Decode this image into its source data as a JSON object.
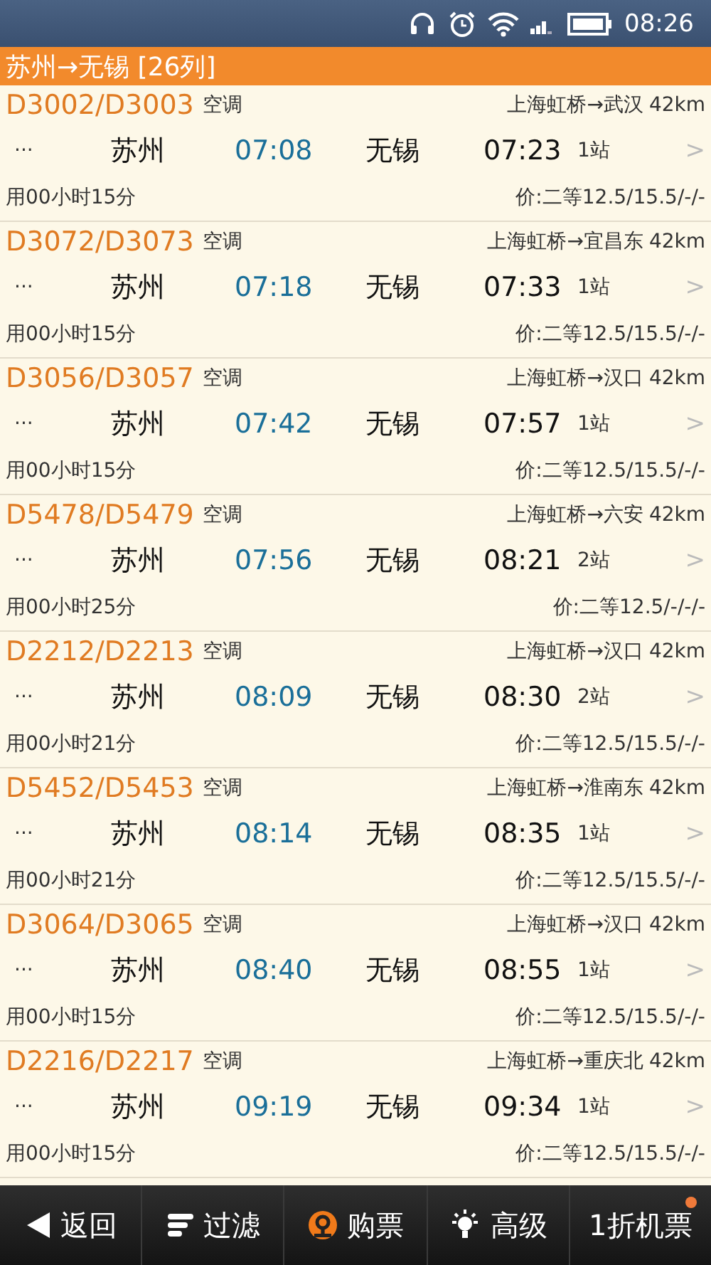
{
  "status_bar": {
    "time": "08:26"
  },
  "header": {
    "title": "苏州→无锡 [26列]"
  },
  "trains": [
    {
      "number": "D3002/D3003",
      "type": "空调",
      "route": "上海虹桥→武汉",
      "distance": "42km",
      "more": "···",
      "from": "苏州",
      "depart": "07:08",
      "to": "无锡",
      "arrive": "07:23",
      "stops": "1站",
      "arrow": ">",
      "duration": "用00小时15分",
      "price": "价:二等12.5/15.5/-/-"
    },
    {
      "number": "D3072/D3073",
      "type": "空调",
      "route": "上海虹桥→宜昌东",
      "distance": "42km",
      "more": "···",
      "from": "苏州",
      "depart": "07:18",
      "to": "无锡",
      "arrive": "07:33",
      "stops": "1站",
      "arrow": ">",
      "duration": "用00小时15分",
      "price": "价:二等12.5/15.5/-/-"
    },
    {
      "number": "D3056/D3057",
      "type": "空调",
      "route": "上海虹桥→汉口",
      "distance": "42km",
      "more": "···",
      "from": "苏州",
      "depart": "07:42",
      "to": "无锡",
      "arrive": "07:57",
      "stops": "1站",
      "arrow": ">",
      "duration": "用00小时15分",
      "price": "价:二等12.5/15.5/-/-"
    },
    {
      "number": "D5478/D5479",
      "type": "空调",
      "route": "上海虹桥→六安",
      "distance": "42km",
      "more": "···",
      "from": "苏州",
      "depart": "07:56",
      "to": "无锡",
      "arrive": "08:21",
      "stops": "2站",
      "arrow": ">",
      "duration": "用00小时25分",
      "price": "价:二等12.5/-/-/-"
    },
    {
      "number": "D2212/D2213",
      "type": "空调",
      "route": "上海虹桥→汉口",
      "distance": "42km",
      "more": "···",
      "from": "苏州",
      "depart": "08:09",
      "to": "无锡",
      "arrive": "08:30",
      "stops": "2站",
      "arrow": ">",
      "duration": "用00小时21分",
      "price": "价:二等12.5/15.5/-/-"
    },
    {
      "number": "D5452/D5453",
      "type": "空调",
      "route": "上海虹桥→淮南东",
      "distance": "42km",
      "more": "···",
      "from": "苏州",
      "depart": "08:14",
      "to": "无锡",
      "arrive": "08:35",
      "stops": "1站",
      "arrow": ">",
      "duration": "用00小时21分",
      "price": "价:二等12.5/15.5/-/-"
    },
    {
      "number": "D3064/D3065",
      "type": "空调",
      "route": "上海虹桥→汉口",
      "distance": "42km",
      "more": "···",
      "from": "苏州",
      "depart": "08:40",
      "to": "无锡",
      "arrive": "08:55",
      "stops": "1站",
      "arrow": ">",
      "duration": "用00小时15分",
      "price": "价:二等12.5/15.5/-/-"
    },
    {
      "number": "D2216/D2217",
      "type": "空调",
      "route": "上海虹桥→重庆北",
      "distance": "42km",
      "more": "···",
      "from": "苏州",
      "depart": "09:19",
      "to": "无锡",
      "arrive": "09:34",
      "stops": "1站",
      "arrow": ">",
      "duration": "用00小时15分",
      "price": "价:二等12.5/15.5/-/-"
    }
  ],
  "toolbar": [
    {
      "kind": "back",
      "label": "返回"
    },
    {
      "kind": "filter",
      "label": "过滤"
    },
    {
      "kind": "ticket",
      "label": "购票"
    },
    {
      "kind": "advanced",
      "label": "高级"
    },
    {
      "kind": "flight",
      "label": "1折机票",
      "badge": true
    }
  ]
}
